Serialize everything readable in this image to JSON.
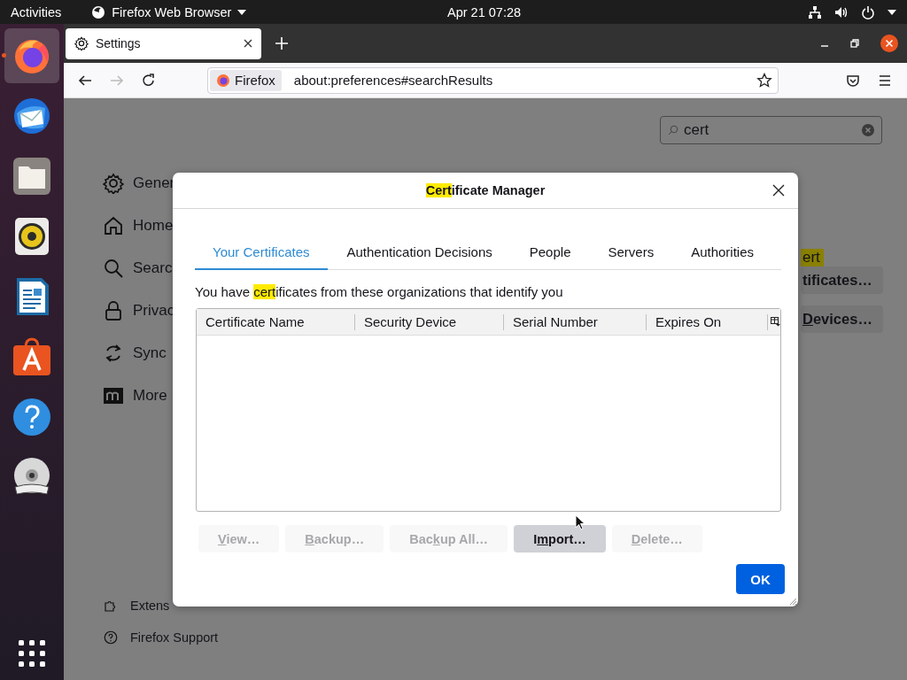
{
  "top_bar": {
    "activities": "Activities",
    "app_menu": "Firefox Web Browser",
    "clock": "Apr 21  07:28"
  },
  "dock": [
    {
      "kind": "browser",
      "active": true
    },
    {
      "kind": "mail",
      "active": false
    },
    {
      "kind": "files",
      "active": false
    },
    {
      "kind": "music",
      "active": false
    },
    {
      "kind": "writer",
      "active": false
    },
    {
      "kind": "software",
      "active": false
    },
    {
      "kind": "help",
      "active": false
    },
    {
      "kind": "disc",
      "active": false
    }
  ],
  "browser": {
    "tabs": [
      {
        "label": "Settings",
        "selected": true
      }
    ],
    "nav": {
      "back_disabled": false,
      "forward_disabled": true
    },
    "address": {
      "identity": "Firefox",
      "url": "about:preferences#searchResults"
    }
  },
  "settings": {
    "search": {
      "value": "cert"
    },
    "nav_items": [
      {
        "kind": "general",
        "label": "Gener"
      },
      {
        "kind": "home",
        "label": "Home"
      },
      {
        "kind": "search",
        "label": "Searc"
      },
      {
        "kind": "privacy",
        "label": "Privac"
      },
      {
        "kind": "sync",
        "label": "Sync"
      },
      {
        "kind": "more",
        "label": "More"
      }
    ],
    "footer_items": [
      {
        "kind": "extensions",
        "label": "Extens"
      },
      {
        "kind": "support",
        "label": "Firefox Support"
      }
    ],
    "behind": [
      {
        "kind": "highlight",
        "label": [
          {
            "text": "ert",
            "underlined": false
          }
        ]
      },
      {
        "kind": "button",
        "label": [
          {
            "text": "tificates…",
            "underlined": false
          }
        ]
      },
      {
        "kind": "button",
        "label": [
          {
            "text": "D",
            "underlined": true
          },
          {
            "text": "evices…",
            "underlined": false
          }
        ]
      }
    ]
  },
  "dialog": {
    "title": [
      {
        "text": "Cert",
        "highlighted": true
      },
      {
        "text": "ificate Manager",
        "highlighted": false
      }
    ],
    "tabs": [
      {
        "label": "Your Certificates",
        "selected": true
      },
      {
        "label": "Authentication Decisions",
        "selected": false
      },
      {
        "label": "People",
        "selected": false
      },
      {
        "label": "Servers",
        "selected": false
      },
      {
        "label": "Authorities",
        "selected": false
      }
    ],
    "description": [
      {
        "text": "You have ",
        "highlighted": false
      },
      {
        "text": "cert",
        "highlighted": true
      },
      {
        "text": "ificates from these organizations that identify you",
        "highlighted": false
      }
    ],
    "table": {
      "columns": [
        "Certificate Name",
        "Security Device",
        "Serial Number",
        "Expires On"
      ]
    },
    "buttons": [
      {
        "label": [
          {
            "text": "V",
            "underlined": true
          },
          {
            "text": "iew…",
            "underlined": false
          }
        ],
        "disabled": true,
        "hovered": false
      },
      {
        "label": [
          {
            "text": "B",
            "underlined": true
          },
          {
            "text": "ackup…",
            "underlined": false
          }
        ],
        "disabled": true,
        "hovered": false
      },
      {
        "label": [
          {
            "text": "Bac",
            "underlined": false
          },
          {
            "text": "k",
            "underlined": true
          },
          {
            "text": "up All…",
            "underlined": false
          }
        ],
        "disabled": true,
        "hovered": false
      },
      {
        "label": [
          {
            "text": "I",
            "underlined": false
          },
          {
            "text": "m",
            "underlined": true
          },
          {
            "text": "port…",
            "underlined": false
          }
        ],
        "disabled": false,
        "hovered": true
      },
      {
        "label": [
          {
            "text": "D",
            "underlined": true
          },
          {
            "text": "elete…",
            "underlined": false
          }
        ],
        "disabled": true,
        "hovered": false
      }
    ],
    "ok": "OK"
  }
}
